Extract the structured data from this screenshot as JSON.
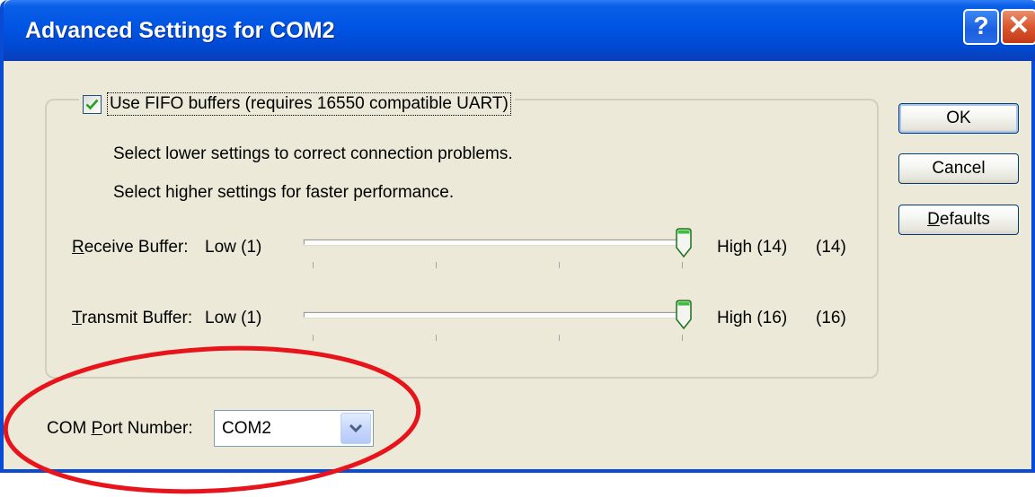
{
  "window": {
    "title": "Advanced Settings for COM2",
    "help_glyph": "?",
    "close_glyph": "✕"
  },
  "fifo": {
    "checked": true,
    "label": "Use FIFO buffers (requires 16550 compatible UART)"
  },
  "info": {
    "line1": "Select lower settings to correct connection problems.",
    "line2": "Select higher settings for faster performance."
  },
  "receive": {
    "label_mnemonic": "R",
    "label_rest": "eceive Buffer:",
    "low": "Low (1)",
    "high": "High (14)",
    "value_display": "(14)",
    "value": 14,
    "min": 1,
    "max": 14
  },
  "transmit": {
    "label_mnemonic": "T",
    "label_rest": "ransmit Buffer:",
    "low": "Low (1)",
    "high": "High (16)",
    "value_display": "(16)",
    "value": 16,
    "min": 1,
    "max": 16
  },
  "buttons": {
    "ok": "OK",
    "cancel": "Cancel",
    "defaults_mnemonic": "D",
    "defaults_rest": "efaults"
  },
  "com_port": {
    "label_prefix": "COM ",
    "label_mnemonic": "P",
    "label_rest": "ort Number:",
    "selected": "COM2"
  },
  "colors": {
    "titlebar": "#0054e3",
    "dialog_bg": "#ece9d8",
    "annotation": "#e8141c",
    "thumb_accent": "#21a121"
  },
  "icons": {
    "checkbox": "checkmark-icon",
    "combo": "chevron-down-icon",
    "slider_thumb": "slider-thumb-icon"
  }
}
